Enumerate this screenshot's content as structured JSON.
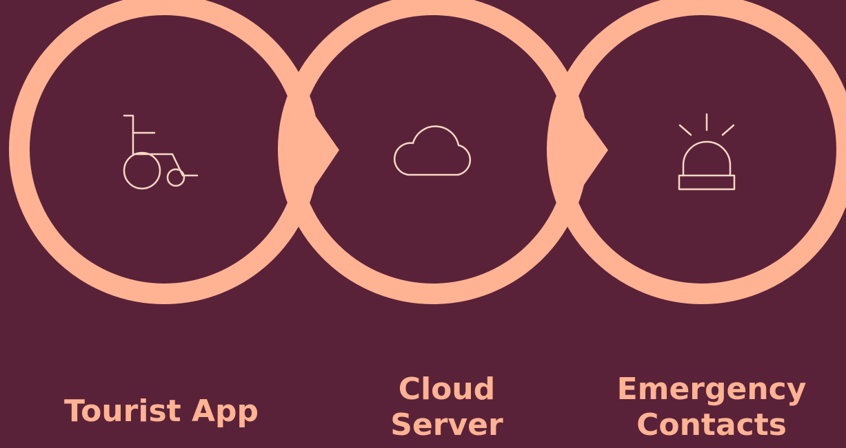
{
  "colors": {
    "background": "#5a2239",
    "accent": "#ffb393",
    "icon": "#f8d8c4"
  },
  "steps": [
    {
      "icon": "wheelchair-icon",
      "label_lines": [
        "Tourist App"
      ]
    },
    {
      "icon": "cloud-icon",
      "label_lines": [
        "Cloud",
        "Server"
      ]
    },
    {
      "icon": "alarm-siren-icon",
      "label_lines": [
        "Emergency",
        "Contacts"
      ]
    }
  ]
}
